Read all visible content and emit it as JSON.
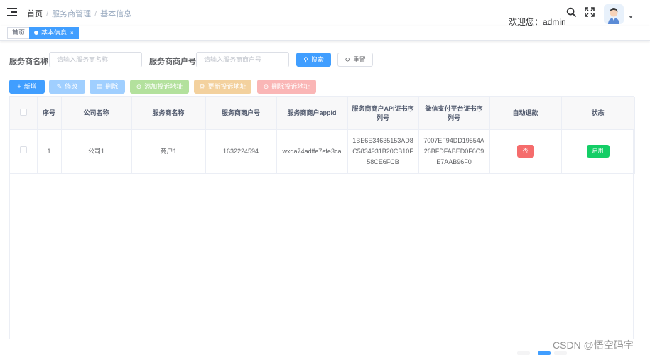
{
  "breadcrumb": {
    "home": "首页",
    "sep": "/",
    "level2": "服务商管理",
    "level3": "基本信息"
  },
  "header": {
    "welcome": "欢迎您：admin"
  },
  "tags": {
    "home": "首页",
    "active": "基本信息",
    "close": "×"
  },
  "search": {
    "name_label": "服务商名称",
    "name_placeholder": "请输入服务商名称",
    "mchid_label": "服务商商户号",
    "mchid_placeholder": "请输入服务商商户号",
    "search_btn": "搜索",
    "reset_btn": "重置"
  },
  "toolbar": {
    "add": "新增",
    "edit": "修改",
    "delete": "删除",
    "add_complaint": "添加投诉地址",
    "update_complaint": "更新投诉地址",
    "delete_complaint": "删除投诉地址"
  },
  "table": {
    "headers": [
      "序号",
      "公司名称",
      "服务商名称",
      "服务商商户号",
      "服务商商户appId",
      "服务商商户API证书序列号",
      "微信支付平台证书序列号",
      "自动退款",
      "状态"
    ],
    "rows": [
      {
        "index": "1",
        "company": "公司1",
        "provider": "商户1",
        "mchid": "1632224594",
        "appid": "wxda74adffe7efe3ca",
        "api_cert": "1BE6E34635153AD8C5834931B20CB10F58CE6FCB",
        "platform_cert": "7007EF94DD19554A26BFDFABED0F6C9E7AAB96F0",
        "auto_refund": "否",
        "status": "启用"
      }
    ]
  },
  "colors": {
    "primary": "#409eff",
    "danger": "#f56c6c",
    "success": "#13ce66"
  },
  "watermark": "CSDN @悟空码字"
}
